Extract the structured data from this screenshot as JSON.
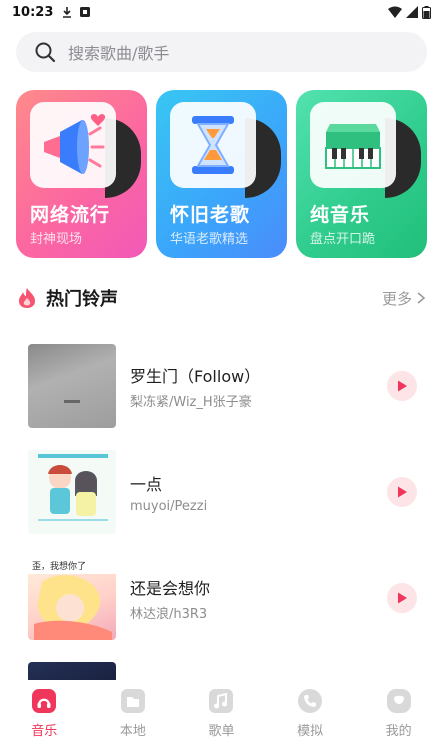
{
  "status_bar": {
    "time": "10:23"
  },
  "search": {
    "placeholder": "搜索歌曲/歌手"
  },
  "categories": [
    {
      "title": "网络流行",
      "subtitle": "封神现场"
    },
    {
      "title": "怀旧老歌",
      "subtitle": "华语老歌精选"
    },
    {
      "title": "纯音乐",
      "subtitle": "盘点开口跪"
    }
  ],
  "section": {
    "title": "热门铃声",
    "more": "更多"
  },
  "songs": [
    {
      "title": "罗生门（Follow）",
      "artist": "梨冻紧/Wiz_H张子豪"
    },
    {
      "title": "一点",
      "artist": "muyoi/Pezzi"
    },
    {
      "title": "还是会想你",
      "artist": "林达浪/h3R3",
      "cover_text": "歪，我想你了"
    }
  ],
  "bottom_nav": [
    {
      "label": "音乐",
      "active": true
    },
    {
      "label": "本地",
      "active": false
    },
    {
      "label": "歌单",
      "active": false
    },
    {
      "label": "模拟",
      "active": false
    },
    {
      "label": "我的",
      "active": false
    }
  ],
  "colors": {
    "accent": "#f0365a",
    "play_bg": "#fde4e7",
    "card_pink": "#fc67a0",
    "card_blue": "#3ba4fb",
    "card_green": "#2ecb8c"
  },
  "icons": {
    "search": "search-icon",
    "section": "flame-icon",
    "more": "chevron-right-icon",
    "play": "play-icon",
    "nav": [
      "music-icon",
      "folder-icon",
      "playlist-icon",
      "phone-icon",
      "profile-icon"
    ]
  }
}
